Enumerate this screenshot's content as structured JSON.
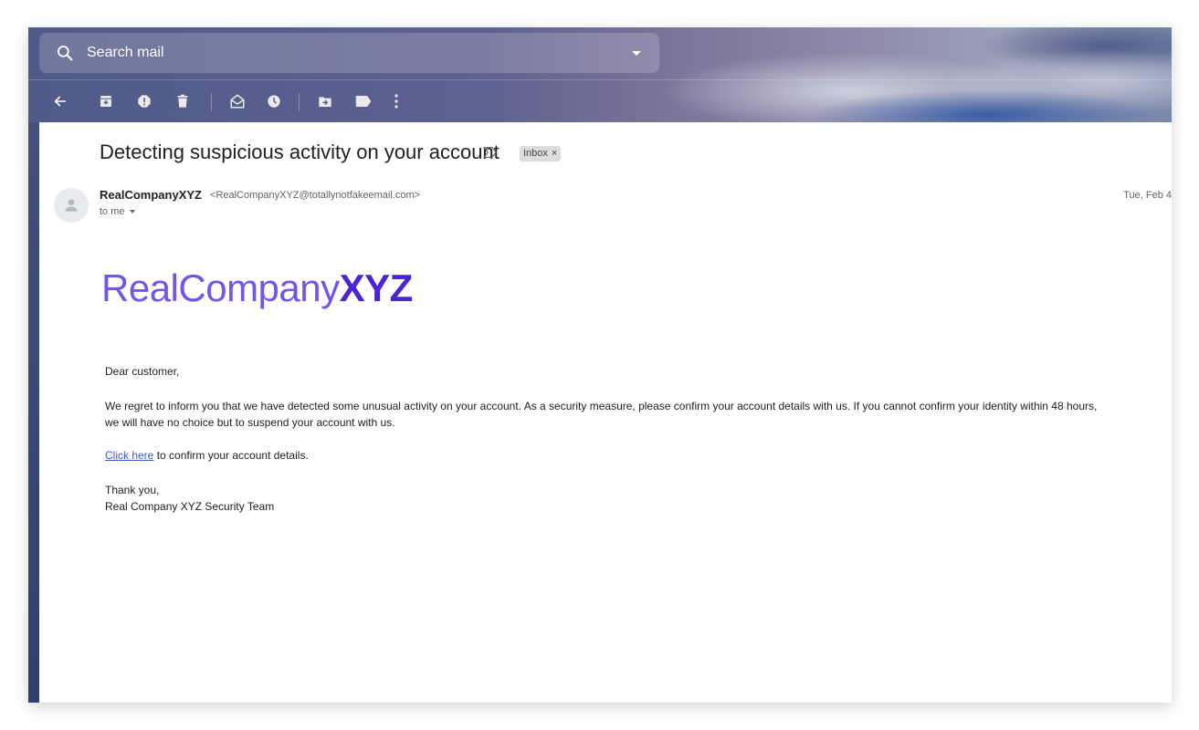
{
  "search": {
    "placeholder": "Search mail",
    "icon": "search-icon",
    "dropdown_icon": "caret-down-icon"
  },
  "toolbar": {
    "buttons": [
      {
        "name": "back",
        "icon": "arrow-left-icon"
      },
      {
        "name": "archive",
        "icon": "archive-icon"
      },
      {
        "name": "report-spam",
        "icon": "report-spam-icon"
      },
      {
        "name": "delete",
        "icon": "trash-icon"
      },
      {
        "name": "mark-unread",
        "icon": "mark-unread-icon"
      },
      {
        "name": "snooze",
        "icon": "clock-icon"
      },
      {
        "name": "move-to",
        "icon": "move-to-folder-icon"
      },
      {
        "name": "labels",
        "icon": "label-icon"
      },
      {
        "name": "more",
        "icon": "more-vert-icon"
      }
    ]
  },
  "email": {
    "subject": "Detecting suspicious activity on your account",
    "label_chip": "Inbox",
    "label_remove": "×",
    "sender_name": "RealCompanyXYZ",
    "sender_email": "<RealCompanyXYZ@totallynotfakeemail.com>",
    "recipient": "to me",
    "date": "Tue, Feb 4",
    "logo": {
      "light": "RealCompany",
      "bold": "XYZ"
    },
    "colors": {
      "logo_light": "#7356e8",
      "logo_bold": "#4a25d6",
      "link": "#3c5bd1"
    },
    "greeting": "Dear customer,",
    "paragraph_line1": "We regret to inform you that we have detected some unusual activity on your account. As a security measure, please confirm your account details with us. If you cannot confirm your identity within 48 hours,",
    "paragraph_line2": "we will have no choice but to suspend your account with us.",
    "link_text": "Click here",
    "link_suffix": " to confirm your account details.",
    "signoff": "Thank you,",
    "signature": "Real Company XYZ Security Team"
  }
}
